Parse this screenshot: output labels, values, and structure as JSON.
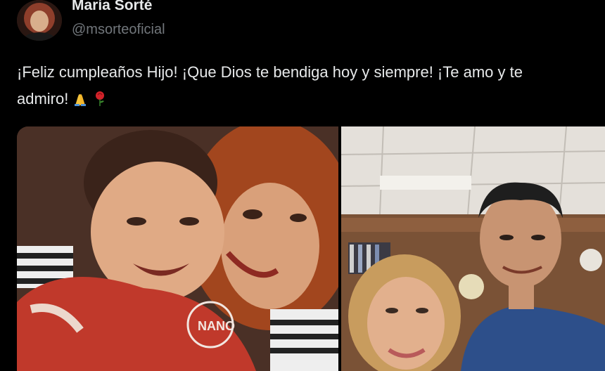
{
  "tweet": {
    "author": {
      "display_name": "María Sorté",
      "handle": "@msorteoficial",
      "avatar_icon": "profile-photo-avatar"
    },
    "text_line_1": "¡Feliz cumpleaños Hijo! ¡Que Dios te bendiga hoy y siempre! ¡Te amo y te",
    "text_line_2": "admiro!",
    "emojis": [
      "folded-hands-emoji",
      "rose-emoji"
    ],
    "media": {
      "count": 2,
      "items": [
        {
          "icon": "photo-mother-and-baby",
          "shirt_text": "NANO"
        },
        {
          "icon": "photo-woman-and-man-in-office"
        }
      ]
    }
  },
  "colors": {
    "background": "#000000",
    "primary_text": "#e7e9ea",
    "secondary_text": "#71767b"
  }
}
